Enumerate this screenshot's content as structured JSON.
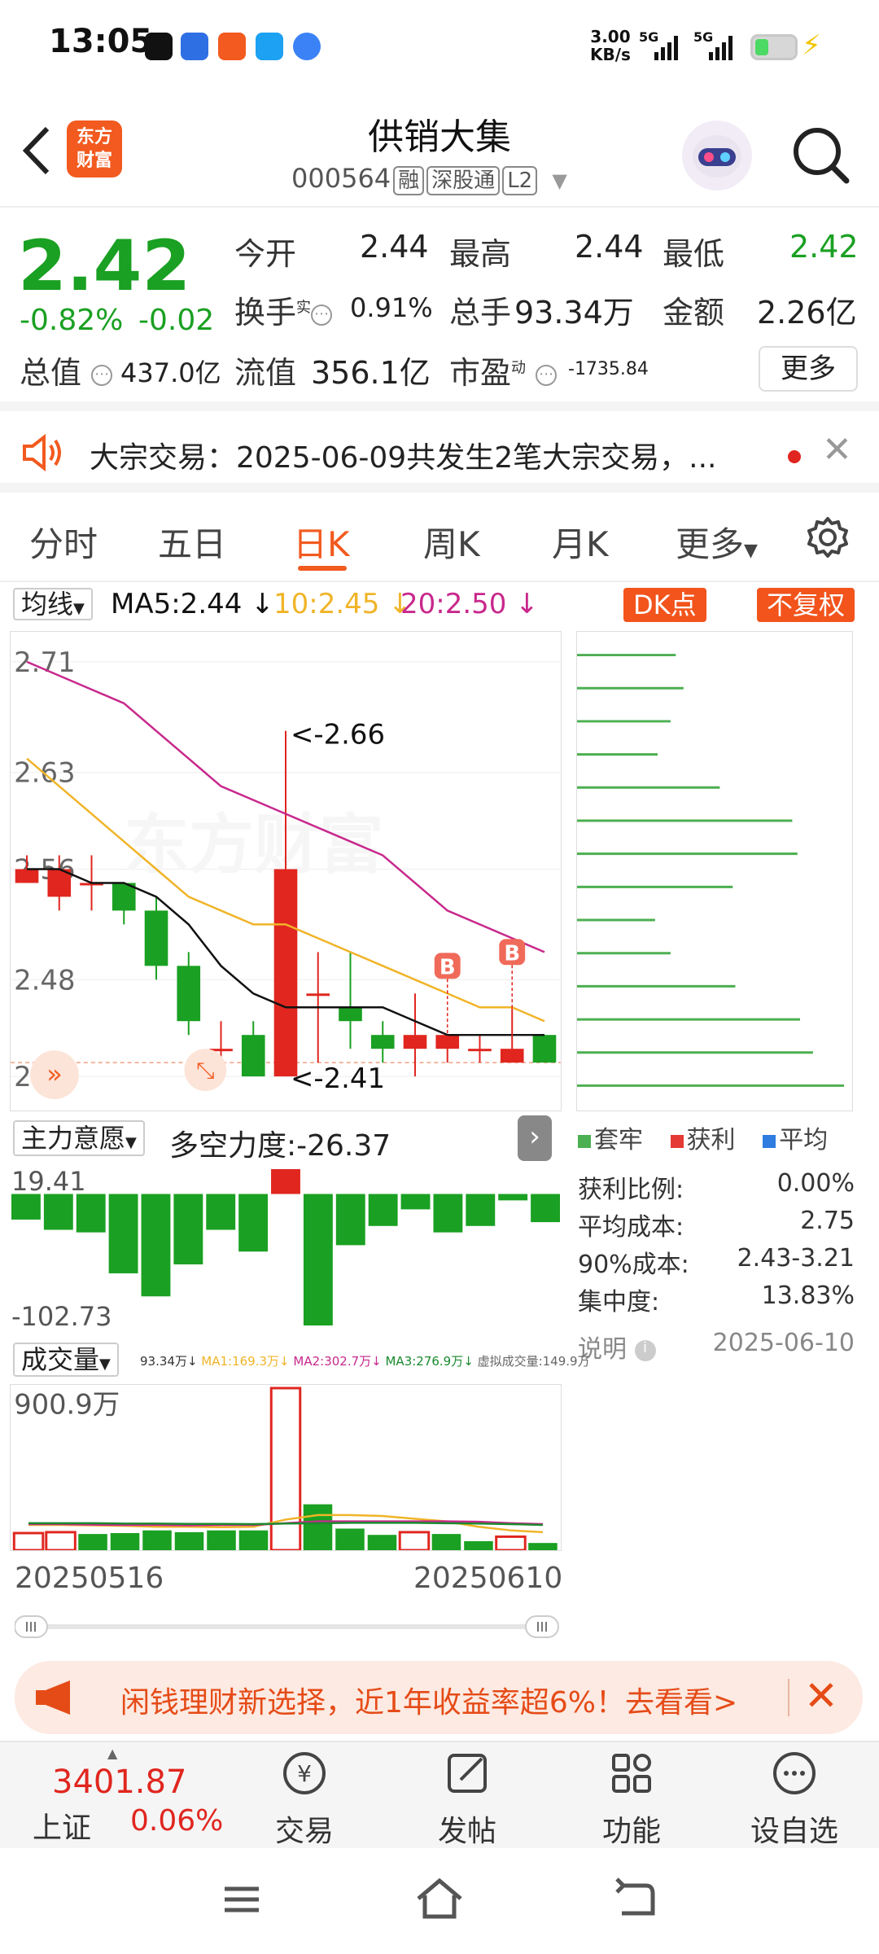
{
  "status_bar": {
    "time": "13:05",
    "net_speed_value": "3.00",
    "net_speed_unit": "KB/s",
    "signal1": "5G",
    "signal2": "5G"
  },
  "header": {
    "logo_text_1": "东方",
    "logo_text_2": "财富",
    "stock_name": "供销大集",
    "stock_code": "000564",
    "tags": [
      "融",
      "深股通",
      "L2"
    ]
  },
  "quote": {
    "price": "2.42",
    "change_pct": "-0.82%",
    "change_val": "-0.02",
    "open_label": "今开",
    "open": "2.44",
    "high_label": "最高",
    "high": "2.44",
    "low_label": "最低",
    "low": "2.42",
    "turnover_label": "换手",
    "turnover_sup": "实",
    "turnover": "0.91%",
    "volume_label": "总手",
    "volume": "93.34万",
    "amount_label": "金额",
    "amount": "2.26亿",
    "mktcap_label": "总值",
    "mktcap": "437.0亿",
    "float_label": "流值",
    "float": "356.1亿",
    "pe_label": "市盈",
    "pe_sup": "动",
    "pe": "-1735.84",
    "more": "更多"
  },
  "announcement": {
    "text": "大宗交易：2025-06-09共发生2笔大宗交易，..."
  },
  "tabs": [
    {
      "label": "分时",
      "active": false
    },
    {
      "label": "五日",
      "active": false
    },
    {
      "label": "日K",
      "active": true
    },
    {
      "label": "周K",
      "active": false
    },
    {
      "label": "月K",
      "active": false
    },
    {
      "label": "更多",
      "active": false
    }
  ],
  "ma_row": {
    "select": "均线",
    "ma5": "MA5:2.44",
    "ma10": "10:2.45",
    "ma20": "20:2.50",
    "dk_btn": "DK点",
    "fq_btn": "不复权"
  },
  "colors": {
    "up": "#e0261f",
    "down": "#1aa022",
    "ma5": "#111111",
    "ma10": "#f0b428",
    "ma20": "#c8288c",
    "accent": "#f25a1f"
  },
  "chart_data": [
    {
      "type": "candlestick",
      "title": "日K",
      "y_ticks": [
        "2.71",
        "2.63",
        "2.56",
        "2.48",
        "2.41"
      ],
      "ylim": [
        2.4,
        2.72
      ],
      "annotations": [
        "<-2.66",
        "<-2.41"
      ],
      "markers": [
        "B",
        "B"
      ],
      "candles": [
        {
          "o": 2.55,
          "c": 2.56,
          "h": 2.57,
          "l": 2.55
        },
        {
          "o": 2.54,
          "c": 2.56,
          "h": 2.57,
          "l": 2.53
        },
        {
          "o": 2.55,
          "c": 2.55,
          "h": 2.57,
          "l": 2.53
        },
        {
          "o": 2.55,
          "c": 2.53,
          "h": 2.55,
          "l": 2.52
        },
        {
          "o": 2.53,
          "c": 2.49,
          "h": 2.54,
          "l": 2.48
        },
        {
          "o": 2.49,
          "c": 2.45,
          "h": 2.5,
          "l": 2.44
        },
        {
          "o": 2.43,
          "c": 2.43,
          "h": 2.45,
          "l": 2.41
        },
        {
          "o": 2.44,
          "c": 2.41,
          "h": 2.45,
          "l": 2.41
        },
        {
          "o": 2.41,
          "c": 2.56,
          "h": 2.66,
          "l": 2.41
        },
        {
          "o": 2.47,
          "c": 2.47,
          "h": 2.5,
          "l": 2.42
        },
        {
          "o": 2.46,
          "c": 2.45,
          "h": 2.5,
          "l": 2.43
        },
        {
          "o": 2.44,
          "c": 2.43,
          "h": 2.45,
          "l": 2.42
        },
        {
          "o": 2.43,
          "c": 2.44,
          "h": 2.47,
          "l": 2.41
        },
        {
          "o": 2.43,
          "c": 2.44,
          "h": 2.44,
          "l": 2.42
        },
        {
          "o": 2.43,
          "c": 2.43,
          "h": 2.44,
          "l": 2.42
        },
        {
          "o": 2.42,
          "c": 2.43,
          "h": 2.46,
          "l": 2.42
        },
        {
          "o": 2.44,
          "c": 2.42,
          "h": 2.44,
          "l": 2.42
        }
      ],
      "series": [
        {
          "name": "MA5",
          "values": [
            2.56,
            2.56,
            2.55,
            2.55,
            2.54,
            2.52,
            2.49,
            2.47,
            2.46,
            2.46,
            2.46,
            2.46,
            2.45,
            2.44,
            2.44,
            2.44,
            2.44
          ]
        },
        {
          "name": "MA10",
          "values": [
            2.64,
            2.62,
            2.6,
            2.58,
            2.56,
            2.54,
            2.53,
            2.52,
            2.52,
            2.51,
            2.5,
            2.49,
            2.48,
            2.47,
            2.46,
            2.46,
            2.45
          ]
        },
        {
          "name": "MA20",
          "values": [
            2.71,
            2.7,
            2.69,
            2.68,
            2.66,
            2.64,
            2.62,
            2.61,
            2.6,
            2.59,
            2.58,
            2.57,
            2.55,
            2.53,
            2.52,
            2.51,
            2.5
          ]
        }
      ]
    },
    {
      "type": "bar",
      "title": "多空力度",
      "y_ticks": [
        "19.41",
        "-102.73"
      ],
      "ylim": [
        -102.73,
        19.41
      ],
      "values": [
        -20,
        -28,
        -30,
        -62,
        -80,
        -55,
        -28,
        -45,
        19.41,
        -102.73,
        -40,
        -25,
        -12,
        -30,
        -25,
        -5,
        -22
      ]
    },
    {
      "type": "bar",
      "title": "成交量",
      "y_ticks": [
        "900.9万"
      ],
      "ylim": [
        0,
        900.9
      ],
      "values": [
        95,
        100,
        90,
        95,
        110,
        100,
        110,
        110,
        900.9,
        255,
        120,
        85,
        100,
        90,
        50,
        75,
        40
      ],
      "up": [
        true,
        true,
        false,
        false,
        false,
        false,
        false,
        false,
        true,
        false,
        false,
        false,
        true,
        false,
        false,
        true,
        false
      ],
      "series": [
        {
          "name": "MA1",
          "values": [
            140,
            140,
            138,
            135,
            130,
            130,
            128,
            130,
            170,
            195,
            195,
            190,
            175,
            160,
            130,
            110,
            100
          ]
        },
        {
          "name": "MA2",
          "values": [
            145,
            145,
            142,
            140,
            140,
            138,
            140,
            140,
            150,
            160,
            160,
            160,
            160,
            160,
            158,
            150,
            145
          ]
        },
        {
          "name": "MA3",
          "values": [
            150,
            150,
            150,
            148,
            148,
            146,
            146,
            145,
            148,
            150,
            152,
            152,
            152,
            150,
            148,
            145,
            140
          ]
        }
      ],
      "x_range": [
        "20250516",
        "20250610"
      ]
    }
  ],
  "chip": {
    "bars": [
      0.35,
      0.38,
      0.33,
      0.28,
      0.52,
      0.8,
      0.82,
      0.57,
      0.27,
      0.33,
      0.58,
      0.83,
      0.88,
      1.0
    ],
    "legend": [
      "套牢",
      "获利",
      "平均"
    ],
    "profit_ratio_label": "获利比例:",
    "profit_ratio": "0.00%",
    "avg_cost_label": "平均成本:",
    "avg_cost": "2.75",
    "cost90_label": "90%成本:",
    "cost90": "2.43-3.21",
    "concentration_label": "集中度:",
    "concentration": "13.83%",
    "note_label": "说明",
    "note_date": "2025-06-10"
  },
  "flow": {
    "select": "主力意愿",
    "text": "多空力度:-26.37"
  },
  "volume": {
    "select": "成交量",
    "legend": [
      "93.34万↓",
      "MA1:169.3万↓",
      "MA2:302.7万↓",
      "MA3:276.9万↓",
      "虚拟成交量:149.9万"
    ]
  },
  "promo": {
    "text": "闲钱理财新选择，近1年收益率超6%！去看看>"
  },
  "bottom_nav": {
    "index_value": "3401.87",
    "index_name": "上证",
    "index_change": "0.06%",
    "items": [
      "交易",
      "发帖",
      "功能",
      "设自选"
    ]
  }
}
